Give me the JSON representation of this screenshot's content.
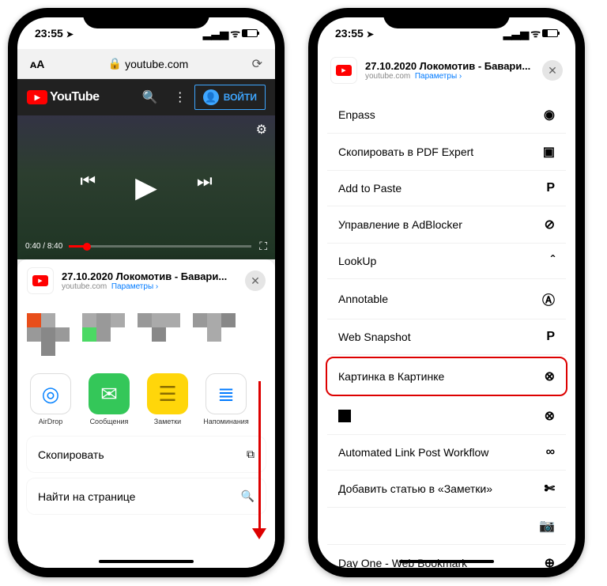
{
  "status": {
    "time": "23:55",
    "loc_arrow": "➤"
  },
  "safari": {
    "aa": "ᴀA",
    "lock": "🔒",
    "domain": "youtube.com"
  },
  "youtube": {
    "brand": "YouTube",
    "signin": "ВОЙТИ",
    "time_current": "0:40",
    "time_total": "8:40"
  },
  "share": {
    "title": "27.10.2020 Локомотив - Бавари...",
    "sub_domain": "youtube.com",
    "sub_link": "Параметры ›"
  },
  "apps": [
    {
      "label": "AirDrop",
      "color": "#fff",
      "glyph": "◎",
      "fg": "#0a84ff"
    },
    {
      "label": "Сообщения",
      "color": "#34c759",
      "glyph": "✉︎"
    },
    {
      "label": "Заметки",
      "color": "#ffd60a",
      "glyph": "☰",
      "fg": "#8a6d00"
    },
    {
      "label": "Напоминания",
      "color": "#fff",
      "glyph": "≣",
      "fg": "#007aff"
    }
  ],
  "actions_left": [
    {
      "label": "Скопировать",
      "icon": "⧉"
    },
    {
      "label": "Найти на странице",
      "icon": "🔍"
    }
  ],
  "actions_right": [
    {
      "label": "Enpass",
      "icon": "◉"
    },
    {
      "label": "Скопировать в PDF Expert",
      "icon": "▣"
    },
    {
      "label": "Add to Paste",
      "icon": "P"
    },
    {
      "label": "Управление в AdBlocker",
      "icon": "⊘"
    },
    {
      "label": "LookUp",
      "icon": "ˆ"
    },
    {
      "label": "Annotable",
      "icon": "Ⓐ"
    },
    {
      "label": "Web Snapshot",
      "icon": "P"
    },
    {
      "label": "Картинка в Картинке",
      "icon": "⊗",
      "highlight": true
    },
    {
      "label": "",
      "icon": "⊗",
      "square": true
    },
    {
      "label": "Automated Link Post Workflow",
      "icon": "∞"
    },
    {
      "label": "Добавить статью в «Заметки»",
      "icon": "✄"
    },
    {
      "label": "",
      "icon": "📷"
    },
    {
      "label": "Day One - Web Bookmark",
      "icon": "⊕"
    }
  ]
}
